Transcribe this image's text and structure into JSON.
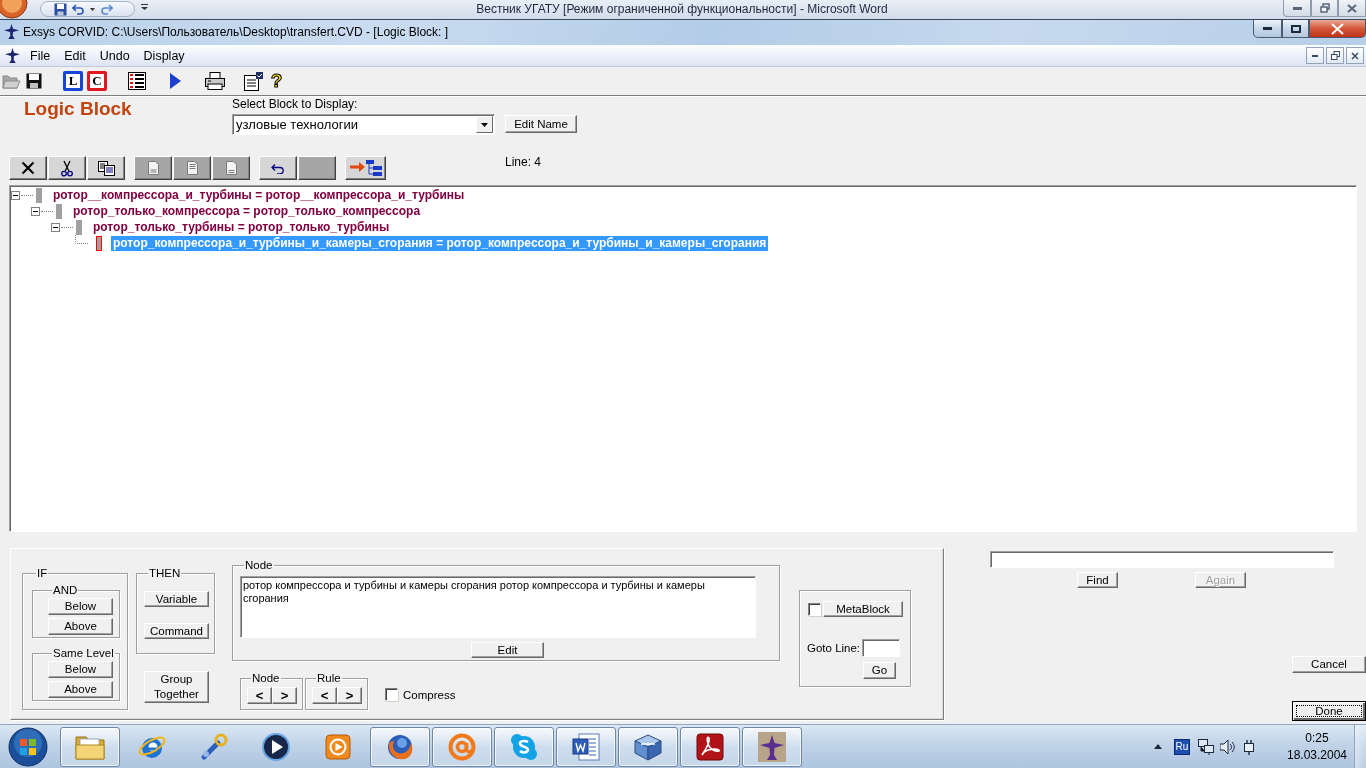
{
  "background_window": {
    "title": "Вестник УГАТУ [Режим ограниченной функциональности] - Microsoft Word"
  },
  "window": {
    "title": "Exsys CORVID: C:\\Users\\Пользователь\\Desktop\\transfert.CVD - [Logic Block: ]"
  },
  "menu": [
    "File",
    "Edit",
    "Undo",
    "Display"
  ],
  "toolbar": [
    {
      "buttons": [
        {
          "kind": "open",
          "disabled": true
        },
        {
          "kind": "save",
          "disabled": false
        }
      ]
    },
    {
      "buttons": [
        {
          "kind": "letter",
          "glyph": "L",
          "color": "#1446d8",
          "disabled": false
        },
        {
          "kind": "letter",
          "glyph": "C",
          "color": "#e01820",
          "disabled": false
        }
      ]
    },
    {
      "buttons": [
        {
          "kind": "list",
          "disabled": false
        }
      ]
    },
    {
      "buttons": [
        {
          "kind": "run",
          "disabled": false
        }
      ]
    },
    {
      "buttons": [
        {
          "kind": "print",
          "disabled": false
        }
      ]
    },
    {
      "buttons": [
        {
          "kind": "properties",
          "disabled": false
        },
        {
          "kind": "help",
          "glyph": "?",
          "disabled": false
        }
      ]
    }
  ],
  "page_title": "Logic Block",
  "block_select": {
    "label": "Select Block to Display:",
    "value": "узловые технологии",
    "button": "Edit Name"
  },
  "block_toolbar": [
    {
      "buttons": [
        {
          "kind": "delete",
          "disabled": false
        },
        {
          "kind": "cut",
          "disabled": false
        },
        {
          "kind": "copy",
          "disabled": false
        }
      ]
    },
    {
      "buttons": [
        {
          "kind": "insert_below",
          "disabled": true
        },
        {
          "kind": "insert_child",
          "disabled": true
        },
        {
          "kind": "insert_above",
          "disabled": true
        }
      ]
    },
    {
      "buttons": [
        {
          "kind": "undo",
          "disabled": false
        },
        {
          "kind": "redo",
          "disabled": true
        }
      ]
    },
    {
      "buttons": [
        {
          "kind": "tree",
          "disabled": false
        }
      ]
    }
  ],
  "line_indicator": "Line: 4",
  "tree": [
    {
      "text": "ротор__компрессора_и_турбины = ротор__компрессора_и_турбины",
      "expanded": true,
      "selected": false,
      "children": [
        {
          "text": "ротор_только_компрессора = ротор_только_компрессора",
          "expanded": true,
          "selected": false,
          "children": [
            {
              "text": "ротор_только_турбины = ротор_только_турбины",
              "expanded": true,
              "selected": false,
              "children": [
                {
                  "text": "ротор_компрессора_и_турбины_и_камеры_сгорания = ротор_компрессора_и_турбины_и_камеры_сгорания",
                  "selected": true
                }
              ]
            }
          ]
        }
      ]
    }
  ],
  "if_group": {
    "title": "IF",
    "subgroups": [
      {
        "title": "AND",
        "buttons": [
          "Below",
          "Above"
        ]
      },
      {
        "title": "Same Level",
        "buttons": [
          "Below",
          "Above"
        ]
      }
    ]
  },
  "then_group": {
    "title": "THEN",
    "buttons": [
      "Variable",
      "Command"
    ]
  },
  "group_button": "Group Together",
  "node_panel": {
    "title": "Node",
    "text": "ротор компрессора и турбины и камеры сгорания ротор компрессора и турбины и камеры сгорания",
    "button": "Edit"
  },
  "navigators": [
    {
      "title": "Node",
      "buttons": [
        "<",
        ">"
      ]
    },
    {
      "title": "Rule",
      "buttons": [
        "<",
        ">"
      ]
    }
  ],
  "compress": {
    "label": "Compress",
    "checked": false
  },
  "metablock": {
    "button": "MetaBlock",
    "checked": false
  },
  "goto_line": {
    "label": "Goto Line:",
    "button": "Go"
  },
  "find": {
    "buttons": [
      {
        "label": "Find",
        "disabled": false
      },
      {
        "label": "Again",
        "disabled": true
      }
    ]
  },
  "dialog_buttons": [
    {
      "label": "Cancel",
      "default": false
    },
    {
      "label": "Done",
      "default": true
    }
  ],
  "taskbar": {
    "items": [
      {
        "kind": "folder",
        "running": true
      },
      {
        "kind": "globe_ring",
        "running": false
      },
      {
        "kind": "wrench",
        "running": false
      },
      {
        "kind": "play_disc",
        "running": false
      },
      {
        "kind": "play_tile",
        "running": false
      },
      {
        "kind": "globe",
        "running": true
      },
      {
        "kind": "at_sign",
        "running": true
      },
      {
        "kind": "bubble",
        "running": true
      },
      {
        "kind": "document",
        "running": true
      },
      {
        "kind": "cube",
        "running": true
      },
      {
        "kind": "swirl_tile",
        "running": true
      },
      {
        "kind": "bird",
        "running": true
      }
    ],
    "language": "Ru",
    "time": "0:25",
    "date": "18.03.2004"
  }
}
